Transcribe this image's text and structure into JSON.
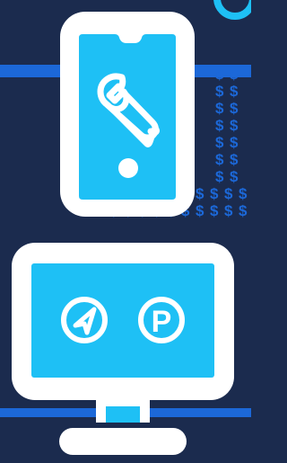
{
  "colors": {
    "background": "#1b2b4e",
    "accent_blue": "#1ec0f5",
    "stripe_blue": "#1c68d8",
    "dollar_pattern": "#1c68d8",
    "device_outline": "#ffffff",
    "device_screen": "#1ec0f5"
  },
  "dollar_pattern": {
    "glyph": "$",
    "rows": [
      [
        "$",
        "$"
      ],
      [
        "$",
        "$"
      ],
      [
        "$",
        "$"
      ],
      [
        "$",
        "$"
      ],
      [
        "$",
        "$"
      ],
      [
        "$",
        "$"
      ],
      [
        "$",
        "$"
      ],
      [
        "$",
        "$",
        "$",
        "$",
        "$",
        "$",
        "$",
        "$",
        "$",
        "$",
        "$"
      ],
      [
        "$",
        "$",
        "$",
        "$",
        "$",
        "$",
        "$",
        "$",
        "$",
        "$",
        "$"
      ]
    ]
  },
  "phone": {
    "screen_icon": "wrench-icon",
    "home_button": "home-button-dot"
  },
  "monitor": {
    "icons": [
      {
        "name": "navigation-arrow-icon"
      },
      {
        "name": "parking-icon",
        "glyph": "P"
      }
    ]
  },
  "corner_badge": {
    "icon": "circle-badge-icon"
  }
}
